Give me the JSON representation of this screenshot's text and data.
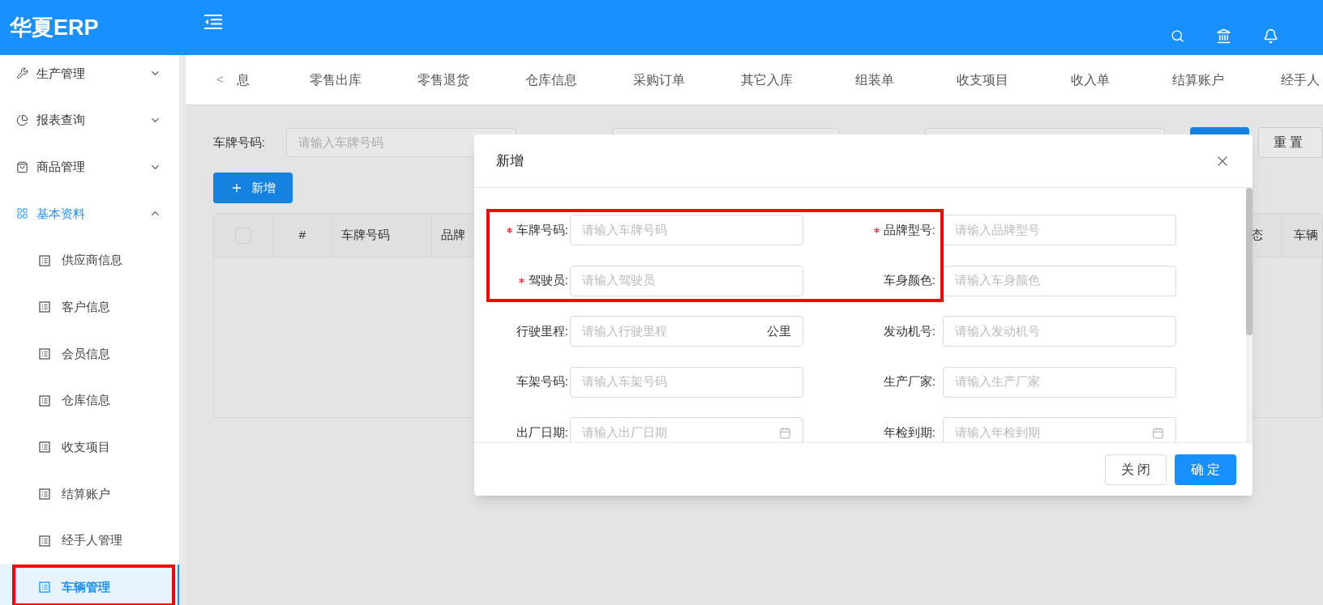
{
  "header": {
    "logo": "华夏ERP"
  },
  "sidebar": {
    "items": [
      {
        "label": "生产管理",
        "expanded": false
      },
      {
        "label": "报表查询",
        "expanded": false
      },
      {
        "label": "商品管理",
        "expanded": false
      },
      {
        "label": "基本资料",
        "expanded": true,
        "children": [
          {
            "label": "供应商信息",
            "selected": false
          },
          {
            "label": "客户信息",
            "selected": false
          },
          {
            "label": "会员信息",
            "selected": false
          },
          {
            "label": "仓库信息",
            "selected": false
          },
          {
            "label": "收支项目",
            "selected": false
          },
          {
            "label": "结算账户",
            "selected": false
          },
          {
            "label": "经手人管理",
            "selected": false
          },
          {
            "label": "车辆管理",
            "selected": true
          }
        ]
      }
    ]
  },
  "tabs": {
    "prev": "<",
    "items": [
      {
        "label": "息",
        "selected": false
      },
      {
        "label": "零售出库",
        "selected": false
      },
      {
        "label": "零售退货",
        "selected": false
      },
      {
        "label": "仓库信息",
        "selected": false
      },
      {
        "label": "采购订单",
        "selected": false
      },
      {
        "label": "其它入库",
        "selected": false
      },
      {
        "label": "组装单",
        "selected": false
      },
      {
        "label": "收支项目",
        "selected": false
      },
      {
        "label": "收入单",
        "selected": false
      },
      {
        "label": "结算账户",
        "selected": false
      },
      {
        "label": "经手人",
        "selected": false
      }
    ]
  },
  "search": {
    "label": "车牌号码:",
    "placeholder": "请输入车牌号码",
    "reset": "重 置"
  },
  "add_button": "新增",
  "table": {
    "select_all_checked": false,
    "columns_left": [
      "#",
      "车牌号码",
      "品牌"
    ],
    "columns_right": [
      "态",
      "车辆"
    ]
  },
  "dialog": {
    "title": "新增",
    "fields": [
      {
        "label": "车牌号码:",
        "placeholder": "请输入车牌号码",
        "required": true,
        "kind": "text"
      },
      {
        "label": "品牌型号:",
        "placeholder": "请输入品牌型号",
        "required": true,
        "kind": "text"
      },
      {
        "label": "驾驶员:",
        "placeholder": "请输入驾驶员",
        "required": true,
        "kind": "text"
      },
      {
        "label": "车身颜色:",
        "placeholder": "请输入车身颜色",
        "required": false,
        "kind": "text"
      },
      {
        "label": "行驶里程:",
        "placeholder": "请输入行驶里程",
        "required": false,
        "kind": "unit",
        "suffix": "公里"
      },
      {
        "label": "发动机号:",
        "placeholder": "请输入发动机号",
        "required": false,
        "kind": "text"
      },
      {
        "label": "车架号码:",
        "placeholder": "请输入车架号码",
        "required": false,
        "kind": "text"
      },
      {
        "label": "生产厂家:",
        "placeholder": "请输入生产厂家",
        "required": false,
        "kind": "text"
      },
      {
        "label": "出厂日期:",
        "placeholder": "请输入出厂日期",
        "required": false,
        "kind": "date"
      },
      {
        "label": "年检到期:",
        "placeholder": "请输入年检到期",
        "required": false,
        "kind": "date"
      }
    ],
    "buttons": [
      "关 闭",
      "确 定"
    ]
  }
}
